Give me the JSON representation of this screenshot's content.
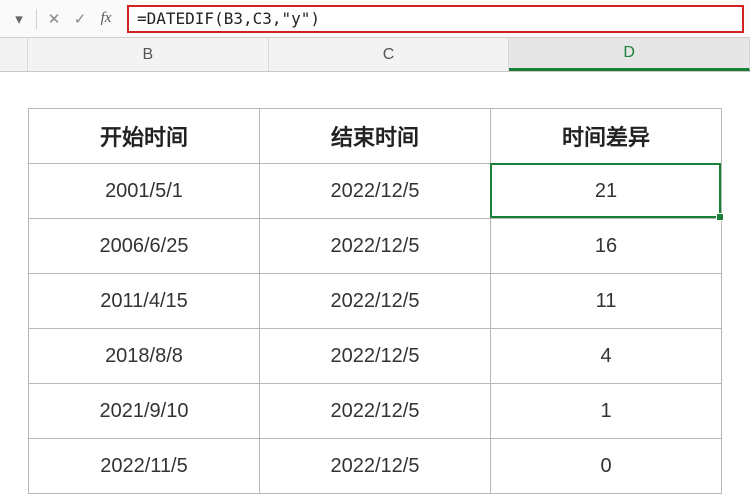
{
  "formula_bar": {
    "dropdown_glyph": "▾",
    "cancel_label": "✕",
    "confirm_label": "✓",
    "fx_label": "fx",
    "formula": "=DATEDIF(B3,C3,\"y\")"
  },
  "columns": {
    "b": "B",
    "c": "C",
    "d": "D"
  },
  "selected_column": "D",
  "headers": {
    "start": "开始时间",
    "end": "结束时间",
    "diff": "时间差异"
  },
  "rows": [
    {
      "start": "2001/5/1",
      "end": "2022/12/5",
      "diff": "21"
    },
    {
      "start": "2006/6/25",
      "end": "2022/12/5",
      "diff": "16"
    },
    {
      "start": "2011/4/15",
      "end": "2022/12/5",
      "diff": "11"
    },
    {
      "start": "2018/8/8",
      "end": "2022/12/5",
      "diff": "4"
    },
    {
      "start": "2021/9/10",
      "end": "2022/12/5",
      "diff": "1"
    },
    {
      "start": "2022/11/5",
      "end": "2022/12/5",
      "diff": "0"
    }
  ],
  "selected_cell": {
    "row": 0,
    "col": "diff"
  }
}
